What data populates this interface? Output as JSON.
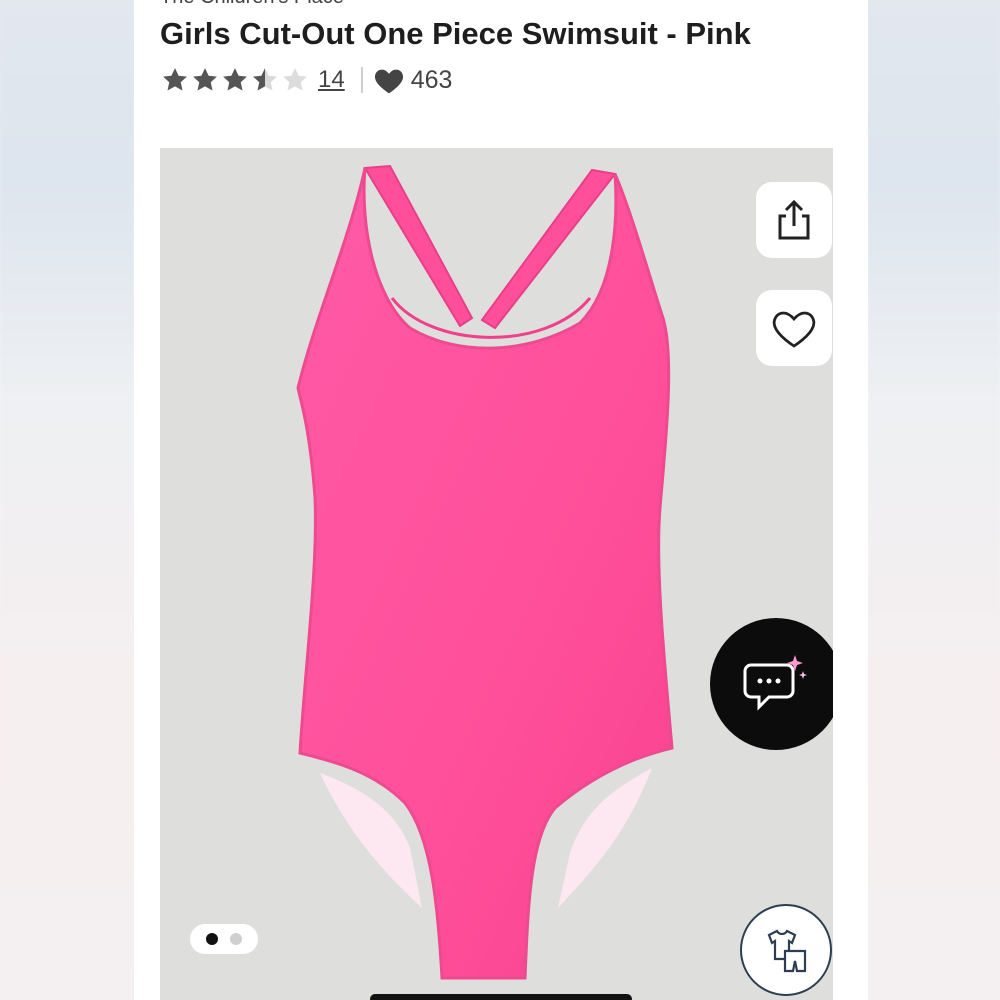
{
  "product": {
    "brand": "The Children's Place",
    "title": "Girls Cut-Out One Piece Swimsuit - Pink",
    "rating": {
      "value": 3.5,
      "max": 5,
      "review_count": "14"
    },
    "likes": "463"
  },
  "gallery": {
    "image_count": 2,
    "active_index": 0,
    "subject": "pink one-piece swimsuit"
  },
  "actions": {
    "share_icon": "share-icon",
    "favorite_icon": "heart-outline-icon",
    "chat_icon": "chat-sparkle-icon",
    "outfit_icon": "outfit-icon"
  },
  "colors": {
    "accent_pink": "#ff4f9a",
    "star": "#555555",
    "chat_bg": "#0c0c0c"
  }
}
